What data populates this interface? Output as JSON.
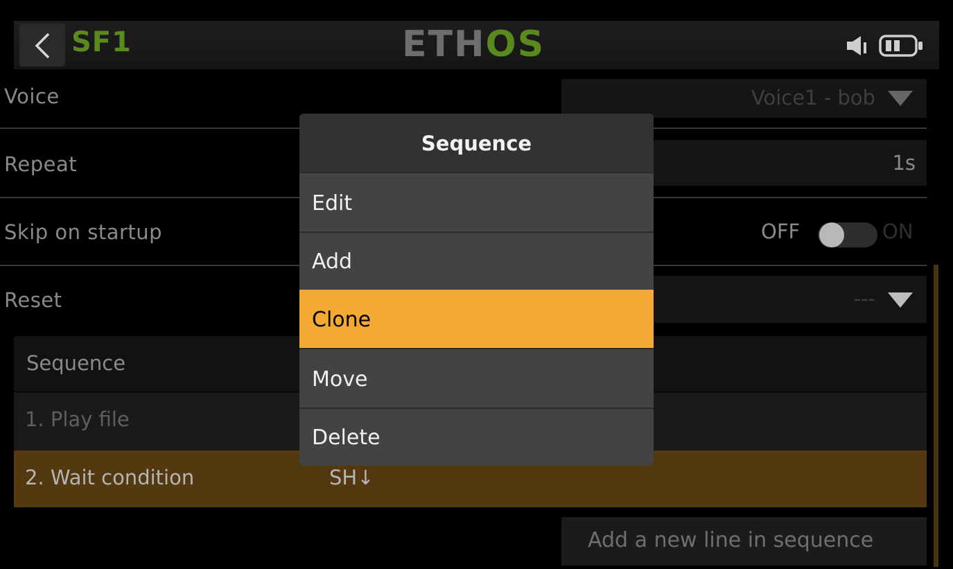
{
  "header": {
    "title": "SF1",
    "logo_left": "ETH",
    "logo_right": "OS"
  },
  "rows": {
    "voice": {
      "label": "Voice",
      "value": "Voice1 - bob"
    },
    "repeat": {
      "label": "Repeat",
      "value": "1s"
    },
    "skip": {
      "label": "Skip on startup",
      "off_label": "OFF",
      "on_label": "ON"
    },
    "reset": {
      "label": "Reset",
      "value": "---"
    }
  },
  "sequence": {
    "header": "Sequence",
    "items": [
      {
        "label": "1. Play file",
        "value": ""
      },
      {
        "label": "2. Wait condition",
        "value": "SH↓"
      }
    ],
    "add_line_label": "Add a new line in sequence"
  },
  "popup": {
    "title": "Sequence",
    "items": [
      "Edit",
      "Add",
      "Clone",
      "Move",
      "Delete"
    ],
    "selected": "Clone"
  },
  "colors": {
    "accent": "#f5a935",
    "brand_green": "#5a8a1e",
    "selected_row": "#533810"
  }
}
